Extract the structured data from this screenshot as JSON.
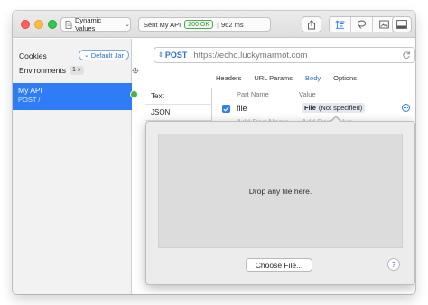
{
  "toolbar": {
    "dynamic_values_label": "Dynamic Values",
    "status_sent_text": "Sent My API",
    "status_code": "200 OK",
    "status_duration": "962 ms"
  },
  "sidebar": {
    "cookies_label": "Cookies",
    "default_jar_label": "Default Jar",
    "environments_label": "Environments",
    "environments_count": "1 »",
    "api_name": "My API",
    "api_method": "POST /"
  },
  "request": {
    "method": "POST",
    "url": "https://echo.luckymarmot.com"
  },
  "tabs": [
    "Headers",
    "URL Params",
    "Body",
    "Options"
  ],
  "active_tab": "Body",
  "body_types": [
    "Text",
    "JSON"
  ],
  "multipart": {
    "col_name": "Part Name",
    "col_value": "Value",
    "row_name": "file",
    "row_value_type": "File",
    "row_value_text": "(Not specified)",
    "placeholder_name": "Add Part Name",
    "placeholder_value": "Add Part Value"
  },
  "popover": {
    "drop_text": "Drop any file here.",
    "choose_label": "Choose File...",
    "help_label": "?"
  },
  "colors": {
    "accent": "#2e7cf6",
    "status_ok": "#4aa84e",
    "env_dot": "#4caf50"
  }
}
